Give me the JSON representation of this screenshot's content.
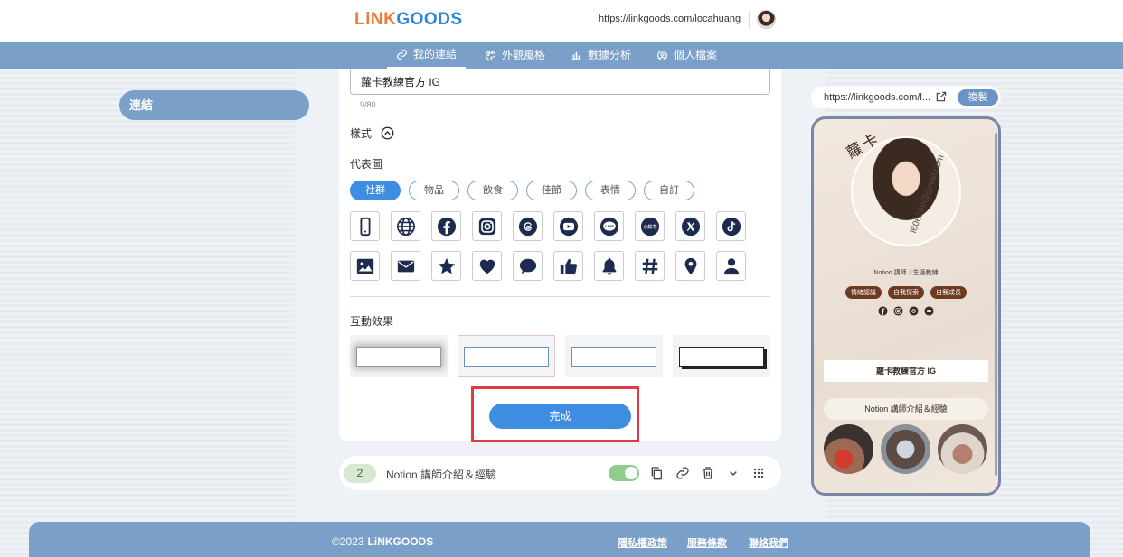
{
  "header": {
    "logo_a": "LiNK",
    "logo_b": "GOODS",
    "profile_url": "https://linkgoods.com/locahuang"
  },
  "nav": {
    "items": [
      {
        "label": "我的連結",
        "icon": "link-icon"
      },
      {
        "label": "外觀風格",
        "icon": "palette-icon"
      },
      {
        "label": "數據分析",
        "icon": "bar-chart-icon"
      },
      {
        "label": "個人檔案",
        "icon": "user-circle-icon"
      }
    ]
  },
  "sidebar": {
    "item": "連結"
  },
  "editor": {
    "title_value": "蘿卡教練官方 IG",
    "char_count": "9/80",
    "style_label": "樣式",
    "icon_section_label": "代表圖",
    "categories": [
      "社群",
      "物品",
      "飲食",
      "佳節",
      "表情",
      "自訂"
    ],
    "active_category": "社群",
    "icons_row1": [
      "phone-icon",
      "globe-icon",
      "facebook-icon",
      "instagram-icon",
      "threads-icon",
      "youtube-icon",
      "line-icon",
      "xiaohongshu-icon",
      "x-icon",
      "tiktok-icon"
    ],
    "icons_row2": [
      "image-icon",
      "mail-icon",
      "star-icon",
      "heart-icon",
      "chat-bubble-icon",
      "thumbs-up-icon",
      "bell-icon",
      "hashtag-icon",
      "location-pin-icon",
      "person-icon"
    ],
    "xiaohongshu_text": "小红书",
    "line_text": "LINE",
    "effect_label": "互動效果",
    "done_label": "完成"
  },
  "link_row": {
    "number": "2",
    "title": "Notion 講師介紹＆經驗"
  },
  "preview": {
    "url": "https://linkgoods.com/l...",
    "copy_label": "複製",
    "name": "蘿卡",
    "email": "l606289@gmail.com",
    "bio": "Notion 講師｜生涯教練",
    "tags": [
      "情緒認識",
      "自我探索",
      "自我成長"
    ],
    "button1": "蘿卡教練官方 IG",
    "button2": "Notion 講師介紹＆經驗"
  },
  "footer": {
    "copyright": "©2023",
    "logo": "LiNKGOODS",
    "links": [
      "隱私權政策",
      "服務條款",
      "聯絡我們"
    ]
  },
  "colors": {
    "accent": "#3f8de0",
    "nav": "#7a9fc8",
    "highlight": "#e23a44",
    "icon_navy": "#1d2b4f"
  }
}
